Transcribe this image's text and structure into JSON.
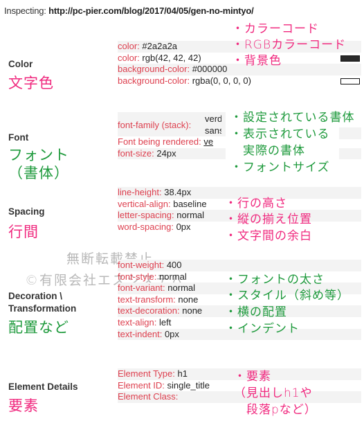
{
  "header": {
    "prefix": "Inspecting:",
    "url": "http://pc-pier.com/blog/2017/04/05/gen-no-mintyo/"
  },
  "colors": {
    "annotation_pink": "#f0287e",
    "annotation_green": "#1e9a3c",
    "property_key": "#dd3f4e",
    "row_shade": "#f3f3f3"
  },
  "sections": {
    "color": {
      "label": "Color",
      "jp_label": "文字色",
      "rows": [
        {
          "key": "color:",
          "value": "#2a2a2a"
        },
        {
          "key": "color:",
          "value": "rgb(42, 42, 42)",
          "swatch": "#2a2a2a"
        },
        {
          "key": "background-color:",
          "value": "#000000"
        },
        {
          "key": "background-color:",
          "value": "rgba(0, 0, 0, 0)",
          "swatch": "transparent"
        }
      ],
      "notes": [
        "・カラーコード",
        "・RGBカラーコード",
        "・背景色"
      ]
    },
    "font": {
      "label": "Font",
      "jp_label_1": "フォント",
      "jp_label_2": "（書体）",
      "rows": [
        {
          "key": "font-family (stack):",
          "value_1": "verd",
          "value_2": "sans"
        },
        {
          "key": "Font being rendered:",
          "value": "ve"
        },
        {
          "key": "font-size:",
          "value": "24px"
        }
      ],
      "notes": [
        "・設定されている書体",
        "・表示されている",
        "　実際の書体",
        "・フォントサイズ"
      ]
    },
    "spacing": {
      "label": "Spacing",
      "jp_label": "行間",
      "rows": [
        {
          "key": "line-height:",
          "value": "38.4px"
        },
        {
          "key": "vertical-align:",
          "value": "baseline"
        },
        {
          "key": "letter-spacing:",
          "value": "normal"
        },
        {
          "key": "word-spacing:",
          "value": "0px"
        }
      ],
      "notes": [
        "・行の高さ",
        "・縦の揃え位置",
        "・文字間の余白"
      ]
    },
    "decoration": {
      "label_1": "Decoration \\",
      "label_2": "Transformation",
      "jp_label": "配置など",
      "rows": [
        {
          "key": "font-weight:",
          "value": "400"
        },
        {
          "key": "font-style:",
          "value": "normal"
        },
        {
          "key": "font-variant:",
          "value": "normal"
        },
        {
          "key": "text-transform:",
          "value": "none"
        },
        {
          "key": "text-decoration:",
          "value": "none"
        },
        {
          "key": "text-align:",
          "value": "left"
        },
        {
          "key": "text-indent:",
          "value": "0px"
        }
      ],
      "notes": [
        "・フォントの太さ",
        "・スタイル（斜め等）",
        "・横の配置",
        "・インデント"
      ]
    },
    "element": {
      "label": "Element Details",
      "jp_label": "要素",
      "rows": [
        {
          "key": "Element Type:",
          "value": "h1"
        },
        {
          "key": "Element ID:",
          "value": "single_title"
        },
        {
          "key": "Element Class:",
          "value": ""
        }
      ],
      "notes": [
        "・要素",
        "（見出しh1や",
        "　段落pなど）"
      ]
    }
  },
  "watermark": {
    "line_1": "無断転載禁止",
    "line_2": "©有限会社エスシステム"
  }
}
